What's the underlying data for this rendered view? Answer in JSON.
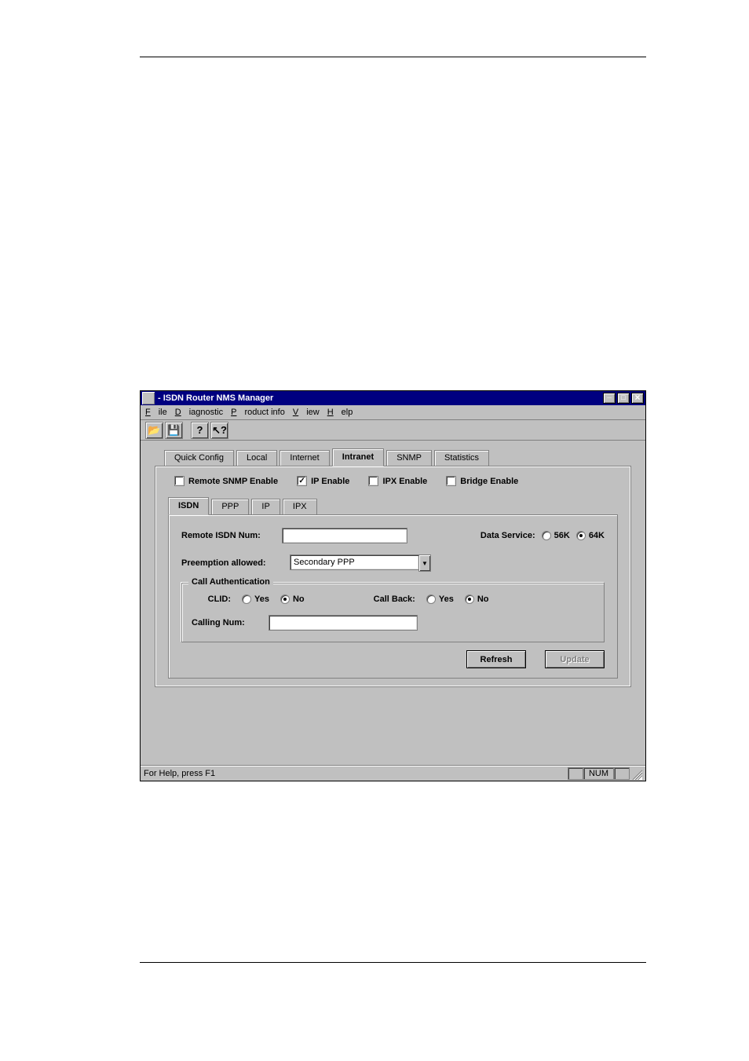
{
  "window": {
    "title": "- ISDN Router NMS Manager"
  },
  "menubar": {
    "file": "File",
    "diagnostic": "Diagnostic",
    "product_info": "Product info",
    "view": "View",
    "help": "Help"
  },
  "toolbar": {
    "open_icon": "📂",
    "save_icon": "💾",
    "help_icon": "?",
    "whatsthis_icon": "⁈"
  },
  "tabs_main": {
    "quick_config": "Quick Config",
    "local": "Local",
    "internet": "Internet",
    "intranet": "Intranet",
    "snmp": "SNMP",
    "statistics": "Statistics"
  },
  "enable_row": {
    "remote_snmp": "Remote SNMP Enable",
    "ip": "IP Enable",
    "ipx": "IPX Enable",
    "bridge": "Bridge Enable"
  },
  "tabs_sub": {
    "isdn": "ISDN",
    "ppp": "PPP",
    "ip": "IP",
    "ipx": "IPX"
  },
  "isdn": {
    "remote_num_label": "Remote ISDN Num:",
    "remote_num_value": "",
    "data_service_label": "Data Service:",
    "ds_56k": "56K",
    "ds_64k": "64K",
    "preemption_label": "Preemption allowed:",
    "preemption_value": "Secondary PPP"
  },
  "call_auth": {
    "legend": "Call Authentication",
    "clid_label": "CLID:",
    "yes": "Yes",
    "no": "No",
    "callback_label": "Call Back:",
    "calling_num_label": "Calling Num:",
    "calling_num_value": ""
  },
  "buttons": {
    "refresh": "Refresh",
    "update": "Update"
  },
  "statusbar": {
    "help": "For Help, press F1",
    "num": "NUM"
  }
}
